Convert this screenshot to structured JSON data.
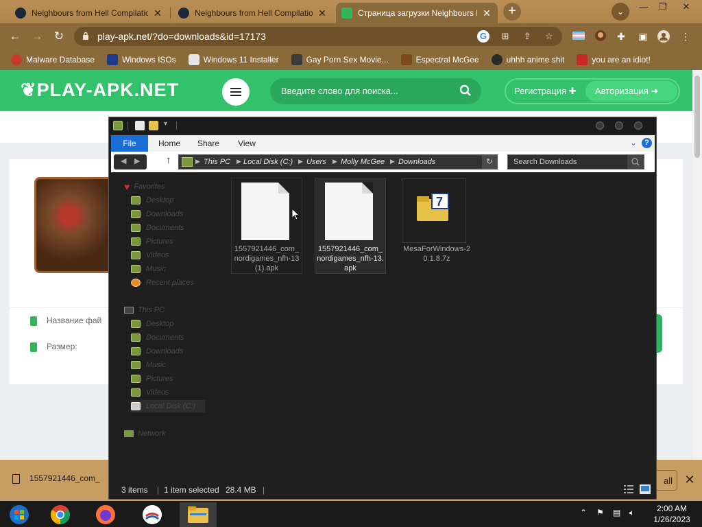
{
  "browser": {
    "tabs": [
      {
        "title": "Neighbours from Hell Compilation",
        "active": false
      },
      {
        "title": "Neighbours from Hell Compilation",
        "active": false
      },
      {
        "title": "Страница загрузки Neighbours Fr",
        "active": true
      }
    ],
    "new_tab_label": "+",
    "url": "play-apk.net/?do=downloads&id=17173",
    "bookmarks": [
      {
        "label": "Malware Database",
        "icon_color": "#c83a2e"
      },
      {
        "label": "Windows ISOs",
        "icon_color": "#1e3a8a"
      },
      {
        "label": "Windows 11 Installer",
        "icon_color": "#e5e5e5"
      },
      {
        "label": "Gay Porn Sex Movie...",
        "icon_color": "#3b3b3b"
      },
      {
        "label": "Espectral McGee",
        "icon_color": "#7a4a1c"
      },
      {
        "label": "uhhh anime shit",
        "icon_color": "#2a2a2a"
      },
      {
        "label": "you are an idiot!",
        "icon_color": "#c62828"
      }
    ]
  },
  "site": {
    "logo": "PLAY-APK.NET",
    "search_placeholder": "Введите слово для поиска...",
    "register_label": "Регистрация",
    "login_label": "Авторизация",
    "file_name_label": "Название фай",
    "size_label": "Размер:",
    "accent_color": "#33c26b"
  },
  "download_bar": {
    "file": "1557921446_com_",
    "show_all": "all"
  },
  "explorer": {
    "ribbon_tabs": [
      "File",
      "Home",
      "Share",
      "View"
    ],
    "breadcrumb": [
      "This PC",
      "Local Disk (C:)",
      "Users",
      "Molly McGee",
      "Downloads"
    ],
    "search_placeholder": "Search Downloads",
    "nav": {
      "favorites_label": "Favorites",
      "favorites": [
        "Desktop",
        "Downloads",
        "Documents",
        "Pictures",
        "Videos",
        "Music",
        "Recent places"
      ],
      "thispc_label": "This PC",
      "thispc": [
        "Desktop",
        "Documents",
        "Downloads",
        "Music",
        "Pictures",
        "Videos",
        "Local Disk (C:)"
      ],
      "network_label": "Network"
    },
    "files": [
      {
        "name": "1557921446_com_nordigames_nfh-13 (1).apk",
        "type": "apk",
        "selected": false
      },
      {
        "name": "1557921446_com_nordigames_nfh-13.apk",
        "type": "apk",
        "selected": true
      },
      {
        "name": "MesaForWindows-20.1.8.7z",
        "type": "7z",
        "selected": false
      }
    ],
    "status": {
      "items": "3 items",
      "selected": "1 item selected",
      "size": "28.4 MB"
    }
  },
  "taskbar": {
    "time": "2:00 AM",
    "date": "1/26/2023"
  }
}
